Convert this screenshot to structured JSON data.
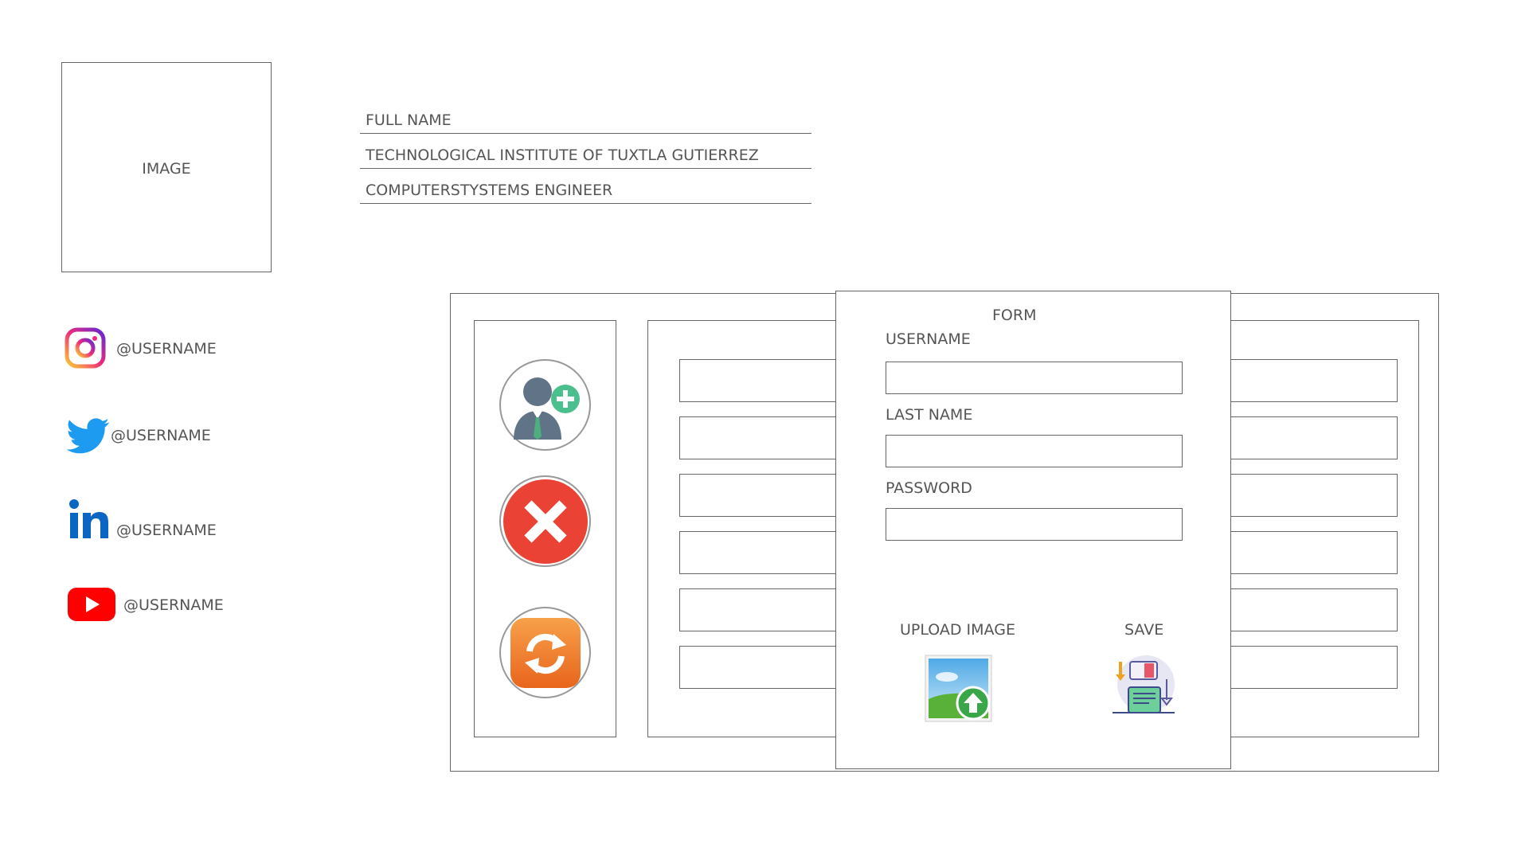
{
  "profile": {
    "image_placeholder": "IMAGE",
    "full_name": "FULL NAME",
    "institute": "TECHNOLOGICAL INSTITUTE OF TUXTLA GUTIERREZ",
    "career": "COMPUTERSTYSTEMS ENGINEER"
  },
  "social": {
    "instagram": "@USERNAME",
    "twitter": "@USERNAME",
    "linkedin": "@USERNAME",
    "youtube": "@USERNAME"
  },
  "actions": {
    "add_user_icon": "add-user-icon",
    "delete_icon": "close-icon",
    "refresh_icon": "refresh-icon"
  },
  "form": {
    "title": "FORM",
    "username_label": "USERNAME",
    "lastname_label": "LAST NAME",
    "password_label": "PASSWORD",
    "username_value": "",
    "lastname_value": "",
    "password_value": "",
    "upload_label": "UPLOAD IMAGE",
    "save_label": "SAVE"
  },
  "colors": {
    "instagram_gradient": [
      "#f9ce34",
      "#ee2a7b",
      "#6228d7"
    ],
    "twitter": "#1d9bf0",
    "linkedin": "#0a66c2",
    "youtube": "#ff0000",
    "delete_red": "#ea4335",
    "refresh_orange": "#f27b21"
  }
}
